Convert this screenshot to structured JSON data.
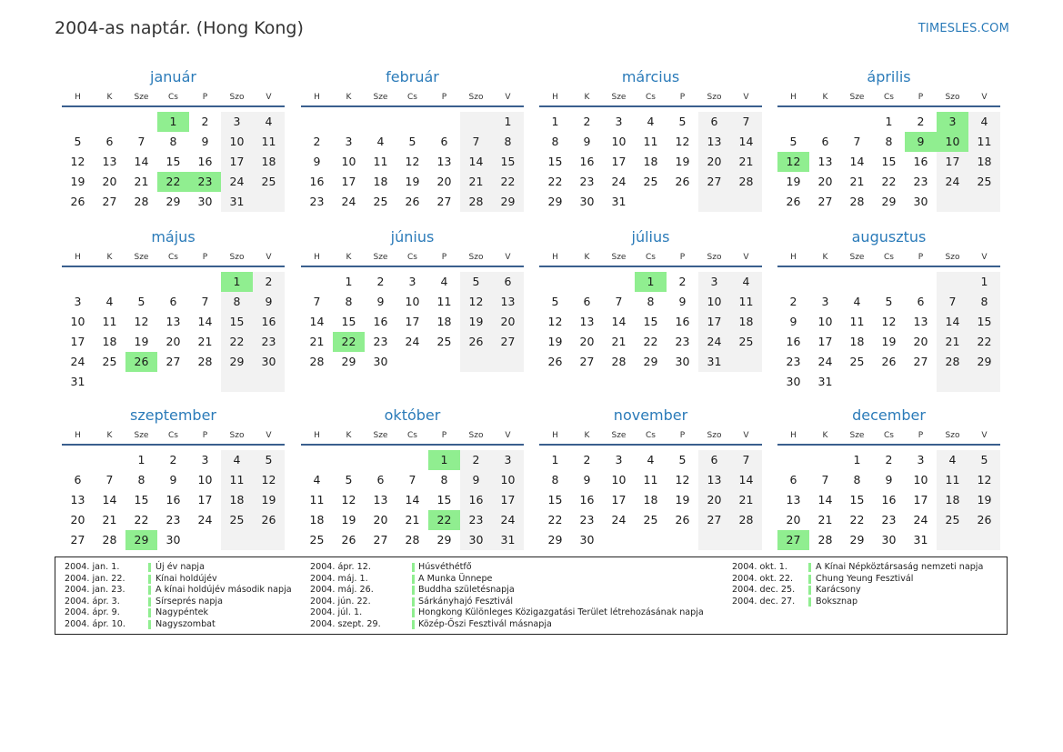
{
  "page": {
    "title": "2004-as naptár. (Hong Kong)",
    "brand": "TIMESLES.COM"
  },
  "weekdays": [
    "H",
    "K",
    "Sze",
    "Cs",
    "P",
    "Szo",
    "V"
  ],
  "colors": {
    "accent": "#2b7bb9",
    "holiday": "#90ee90",
    "weekend": "#f2f2f2",
    "rule": "#3a5f8e"
  },
  "months": [
    {
      "name": "január",
      "start": 3,
      "days": 31,
      "holidays": [
        1,
        22,
        23
      ]
    },
    {
      "name": "február",
      "start": 6,
      "days": 29,
      "holidays": []
    },
    {
      "name": "március",
      "start": 0,
      "days": 31,
      "holidays": []
    },
    {
      "name": "április",
      "start": 3,
      "days": 30,
      "holidays": [
        3,
        9,
        10,
        12
      ]
    },
    {
      "name": "május",
      "start": 5,
      "days": 31,
      "holidays": [
        1,
        26
      ]
    },
    {
      "name": "június",
      "start": 1,
      "days": 30,
      "holidays": [
        22
      ]
    },
    {
      "name": "július",
      "start": 3,
      "days": 31,
      "holidays": [
        1
      ]
    },
    {
      "name": "augusztus",
      "start": 6,
      "days": 31,
      "holidays": []
    },
    {
      "name": "szeptember",
      "start": 2,
      "days": 30,
      "holidays": [
        29
      ]
    },
    {
      "name": "október",
      "start": 4,
      "days": 31,
      "holidays": [
        1,
        22
      ]
    },
    {
      "name": "november",
      "start": 0,
      "days": 30,
      "holidays": []
    },
    {
      "name": "december",
      "start": 2,
      "days": 31,
      "holidays": [
        27
      ]
    }
  ],
  "legend": [
    [
      {
        "date": "2004. jan. 1.",
        "name": "Új év napja"
      },
      {
        "date": "2004. jan. 22.",
        "name": "Kínai holdújév"
      },
      {
        "date": "2004. jan. 23.",
        "name": "A kínai holdújév második napja"
      },
      {
        "date": "2004. ápr. 3.",
        "name": "Sírseprés napja"
      },
      {
        "date": "2004. ápr. 9.",
        "name": "Nagypéntek"
      },
      {
        "date": "2004. ápr. 10.",
        "name": "Nagyszombat"
      }
    ],
    [
      {
        "date": "2004. ápr. 12.",
        "name": "Húsvéthétfő"
      },
      {
        "date": "2004. máj. 1.",
        "name": "A Munka Ünnepe"
      },
      {
        "date": "2004. máj. 26.",
        "name": "Buddha születésnapja"
      },
      {
        "date": "2004. jún. 22.",
        "name": "Sárkányhajó Fesztivál"
      },
      {
        "date": "2004. júl. 1.",
        "name": "Hongkong Különleges Közigazgatási Terület létrehozásának napja"
      },
      {
        "date": "2004. szept. 29.",
        "name": "Közép-Őszi Fesztivál másnapja"
      }
    ],
    [
      {
        "date": "2004. okt. 1.",
        "name": "A Kínai Népköztársaság nemzeti napja"
      },
      {
        "date": "2004. okt. 22.",
        "name": "Chung Yeung Fesztivál"
      },
      {
        "date": "2004. dec. 25.",
        "name": "Karácsony"
      },
      {
        "date": "2004. dec. 27.",
        "name": "Boksznap"
      }
    ]
  ]
}
